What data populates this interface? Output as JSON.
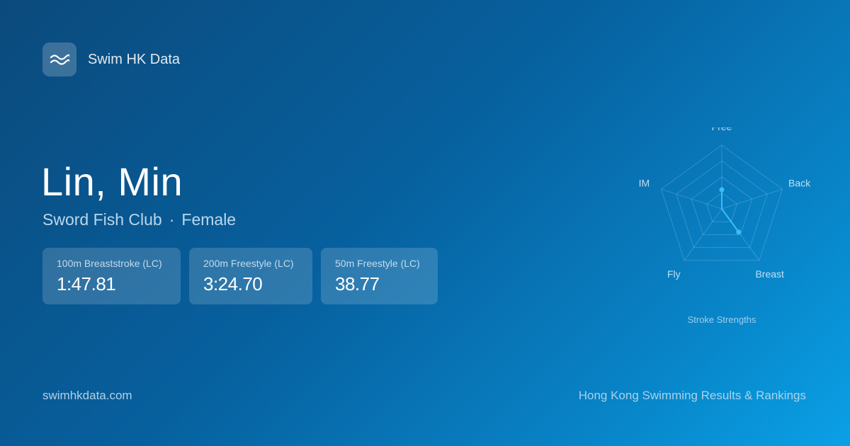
{
  "brand": {
    "name": "Swim HK Data",
    "icon": "waves-icon"
  },
  "swimmer": {
    "name": "Lin, Min",
    "club": "Sword Fish Club",
    "separator": "·",
    "gender": "Female"
  },
  "best_times": [
    {
      "event": "100m Breaststroke (LC)",
      "time": "1:47.81"
    },
    {
      "event": "200m Freestyle (LC)",
      "time": "3:24.70"
    },
    {
      "event": "50m Freestyle (LC)",
      "time": "38.77"
    }
  ],
  "radar": {
    "title": "Stroke Strengths",
    "axes": [
      "Free",
      "Back",
      "Breast",
      "Fly",
      "IM"
    ],
    "values": [
      0.3,
      0.0,
      0.45,
      0.0,
      0.0
    ],
    "scale_max": 1.0,
    "rings": 4,
    "colors": {
      "series": "#38bdf8",
      "grid": "rgba(255,255,255,0.18)"
    }
  },
  "footer": {
    "domain": "swimhkdata.com",
    "tagline": "Hong Kong Swimming Results & Rankings"
  }
}
